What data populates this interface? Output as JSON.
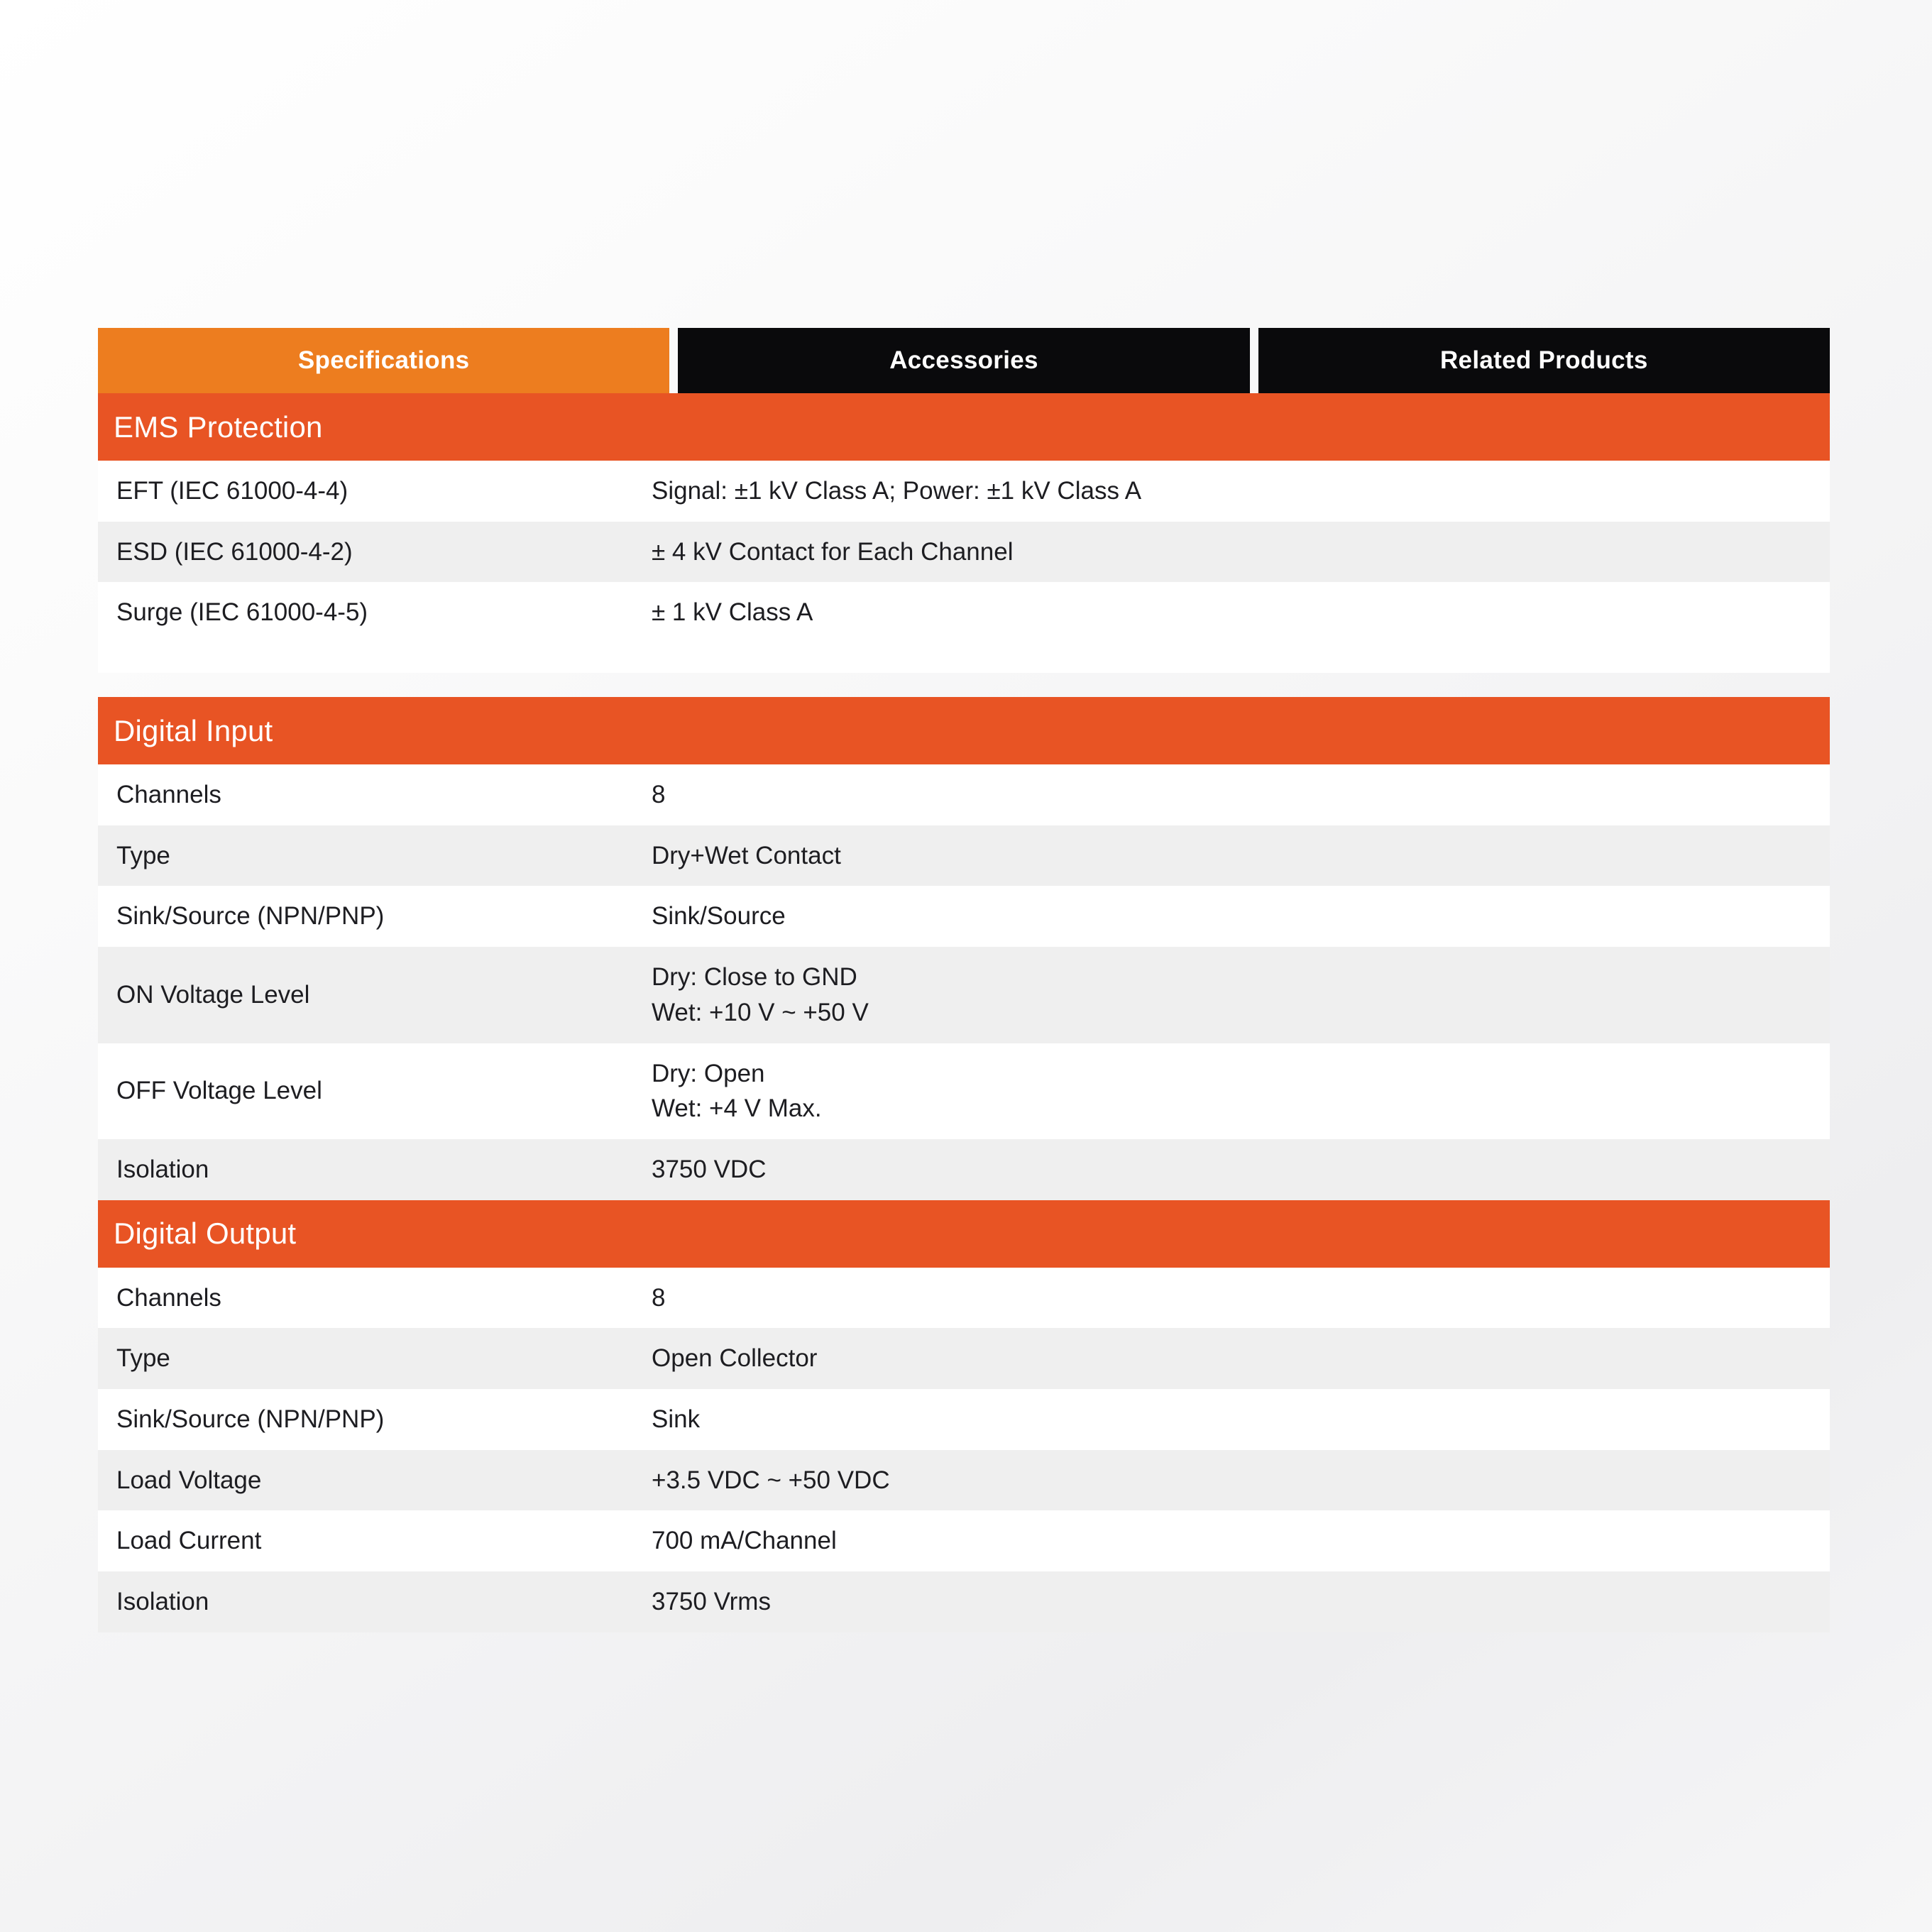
{
  "tabs": [
    {
      "label": "Specifications",
      "active": true
    },
    {
      "label": "Accessories",
      "active": false
    },
    {
      "label": "Related Products",
      "active": false
    }
  ],
  "colors": {
    "tab_active_orange": "#ED7D1F",
    "tab_inactive_black": "#0A0A0C",
    "section_band_orange": "#E85424",
    "row_white": "#FFFFFF",
    "row_alt_gray": "#EFEFEF",
    "text_dark": "#1D1D21",
    "text_on_color": "#FFFFFF"
  },
  "sections": [
    {
      "title": "EMS Protection",
      "rows": [
        {
          "label": "EFT (IEC 61000-4-4)",
          "value": "Signal: ±1 kV Class A; Power: ±1 kV Class A"
        },
        {
          "label": "ESD (IEC 61000-4-2)",
          "value": "± 4 kV Contact for Each Channel"
        },
        {
          "label": "Surge (IEC 61000-4-5)",
          "value": "± 1 kV Class A"
        }
      ]
    },
    {
      "title": "Digital Input",
      "rows": [
        {
          "label": "Channels",
          "value": "8"
        },
        {
          "label": "Type",
          "value": "Dry+Wet Contact"
        },
        {
          "label": "Sink/Source (NPN/PNP)",
          "value": "Sink/Source"
        },
        {
          "label": "ON Voltage Level",
          "value": "Dry: Close to GND\nWet: +10 V ~ +50 V"
        },
        {
          "label": "OFF Voltage Level",
          "value": "Dry: Open\nWet: +4 V Max."
        },
        {
          "label": "Isolation",
          "value": "3750 VDC"
        }
      ]
    },
    {
      "title": "Digital Output",
      "rows": [
        {
          "label": "Channels",
          "value": "8"
        },
        {
          "label": "Type",
          "value": "Open Collector"
        },
        {
          "label": "Sink/Source (NPN/PNP)",
          "value": "Sink"
        },
        {
          "label": "Load Voltage",
          "value": "+3.5 VDC ~ +50 VDC"
        },
        {
          "label": "Load Current",
          "value": "700 mA/Channel"
        },
        {
          "label": "Isolation",
          "value": "3750 Vrms"
        }
      ]
    }
  ]
}
